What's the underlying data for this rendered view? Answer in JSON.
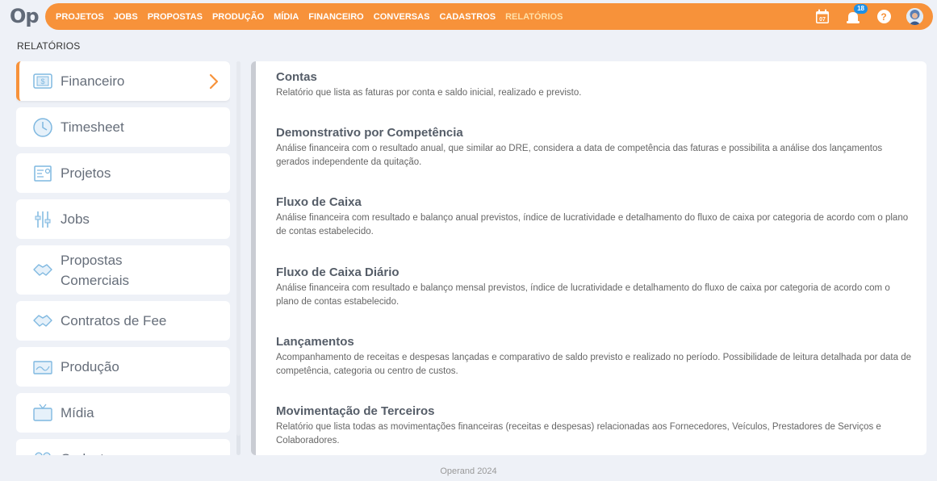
{
  "header": {
    "logo": "Op",
    "nav": [
      "PROJETOS",
      "JOBS",
      "PROPOSTAS",
      "PRODUÇÃO",
      "MÍDIA",
      "FINANCEIRO",
      "CONVERSAS",
      "CADASTROS",
      "RELATÓRIOS"
    ],
    "active_nav": "RELATÓRIOS",
    "calendar_day": "07",
    "notifications_count": "18",
    "help_label": "?",
    "icons": [
      "calendar-icon",
      "notifications-icon",
      "help-icon",
      "avatar"
    ]
  },
  "page": {
    "title": "RELATÓRIOS"
  },
  "sidebar": {
    "items": [
      {
        "label": "Financeiro",
        "icon": "money-icon",
        "active": true
      },
      {
        "label": "Timesheet",
        "icon": "clock-icon"
      },
      {
        "label": "Projetos",
        "icon": "project-icon"
      },
      {
        "label": "Jobs",
        "icon": "tools-icon"
      },
      {
        "label": "Propostas Comerciais",
        "icon": "handshake-icon"
      },
      {
        "label": "Contratos de Fee",
        "icon": "handshake-icon"
      },
      {
        "label": "Produção",
        "icon": "production-icon"
      },
      {
        "label": "Mídia",
        "icon": "tv-icon"
      },
      {
        "label": "Cadastros",
        "icon": "people-icon"
      }
    ]
  },
  "reports": [
    {
      "title": "Contas",
      "desc": "Relatório que lista as faturas por conta e saldo inicial, realizado e previsto."
    },
    {
      "title": "Demonstrativo por Competência",
      "desc": "Análise financeira com o resultado anual, que similar ao DRE, considera a data de competência das faturas e possibilita a análise dos lançamentos gerados independente da quitação."
    },
    {
      "title": "Fluxo de Caixa",
      "desc": "Análise financeira com resultado e balanço anual previstos, índice de lucratividade e detalhamento do fluxo de caixa por categoria de acordo com o plano de contas estabelecido."
    },
    {
      "title": "Fluxo de Caixa Diário",
      "desc": "Análise financeira com resultado e balanço mensal previstos, índice de lucratividade e detalhamento do fluxo de caixa por categoria de acordo com o plano de contas estabelecido."
    },
    {
      "title": "Lançamentos",
      "desc": "Acompanhamento de receitas e despesas lançadas e comparativo de saldo previsto e realizado no período. Possibilidade de leitura detalhada por data de competência, categoria ou centro de custos."
    },
    {
      "title": "Movimentação de Terceiros",
      "desc": "Relatório que lista todas as movimentações financeiras (receitas e despesas) relacionadas aos Fornecedores, Veículos, Prestadores de Serviços e Colaboradores."
    }
  ],
  "footer": {
    "text": "Operand 2024"
  },
  "colors": {
    "accent": "#f7923a",
    "badge": "#1e90e6",
    "icon": "#7fb8e0"
  }
}
